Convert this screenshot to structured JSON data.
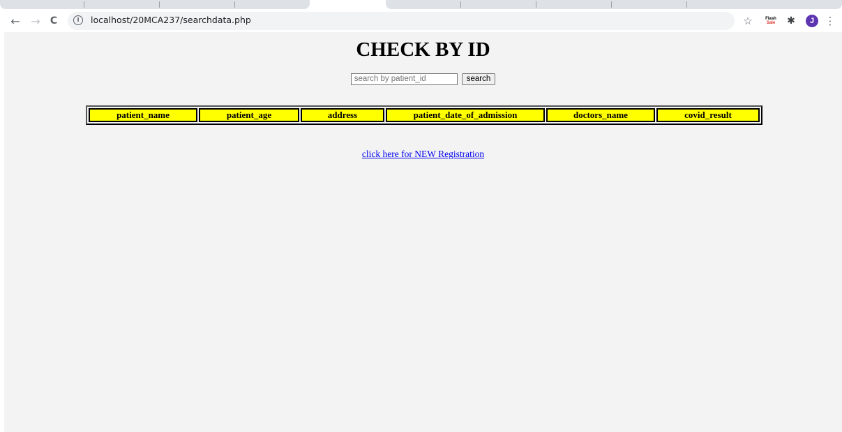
{
  "browser": {
    "url": "localhost/20MCA237/searchdata.php",
    "back_glyph": "←",
    "forward_glyph": "→",
    "reload_glyph": "C",
    "info_glyph": "i",
    "bookmark_glyph": "☆",
    "extension_badge_top": "Flash",
    "extension_badge_bottom": "Sale",
    "extensions_glyph": "✱",
    "profile_initial": "J",
    "menu_glyph": "⋮",
    "icons": [
      "back-arrow-icon",
      "forward-arrow-icon",
      "reload-icon",
      "info-icon",
      "star-icon",
      "flash-sale-extension-icon",
      "puzzle-icon",
      "avatar",
      "kebab-menu-icon"
    ]
  },
  "page": {
    "title": "CHECK BY ID",
    "search": {
      "placeholder": "search by patient_id",
      "value": "",
      "button_label": "search"
    },
    "table": {
      "headers": [
        "patient_name",
        "patient_age",
        "address",
        "patient_date_of_admission",
        "doctors_name",
        "covid_result"
      ],
      "rows": []
    },
    "registration_link": "click here for NEW Registration"
  },
  "colors": {
    "page_background": "#f3f3f4",
    "table_header_background": "#ffff00",
    "link": "#0000ee",
    "avatar": "#5e35b1"
  }
}
